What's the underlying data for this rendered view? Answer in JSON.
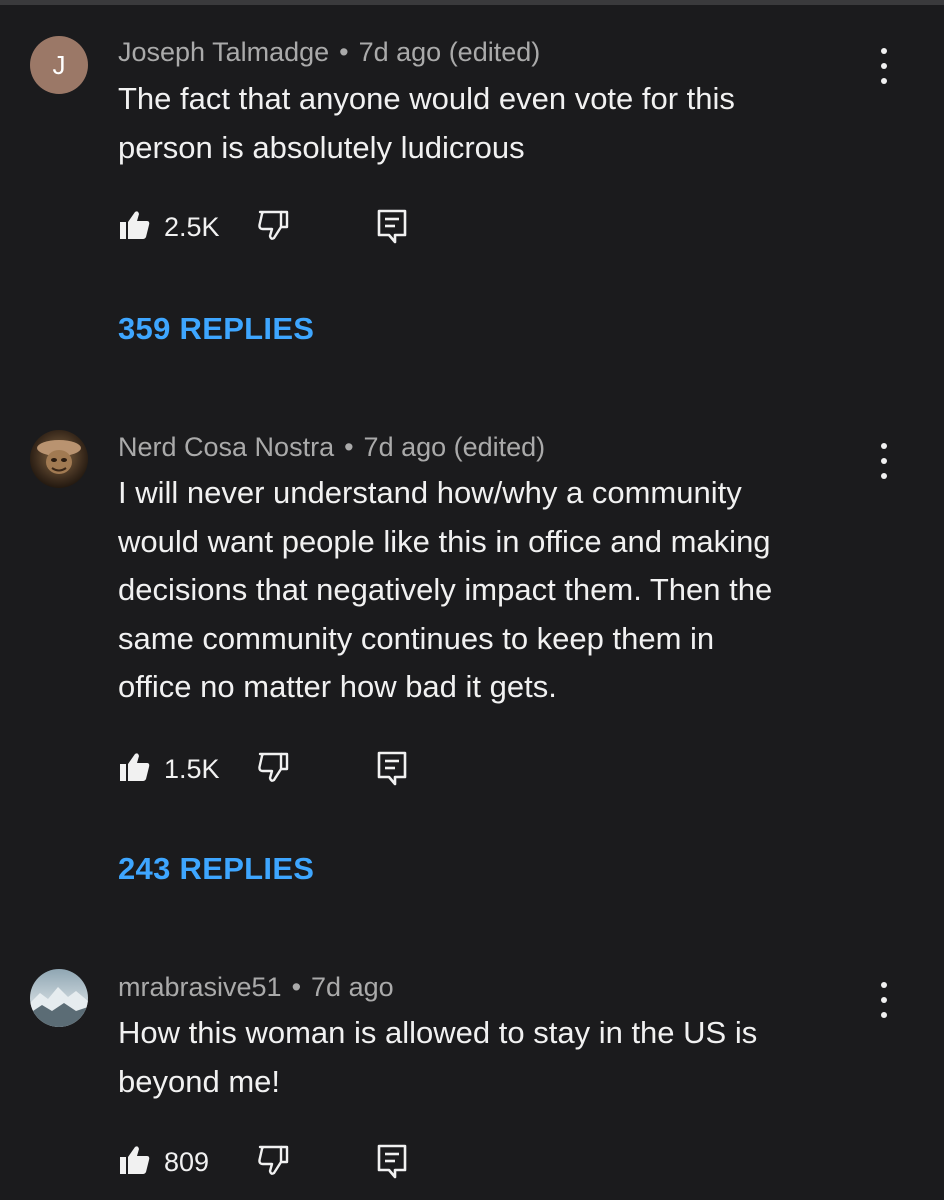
{
  "comments": [
    {
      "avatar_letter": "J",
      "author": "Joseph Talmadge",
      "time": "7d ago (edited)",
      "text_lines": [
        "The fact that anyone would even vote for this",
        "person is absolutely ludicrous"
      ],
      "likes": "2.5K",
      "replies": "359 REPLIES"
    },
    {
      "avatar_letter": "",
      "author": "Nerd Cosa Nostra",
      "time": "7d ago (edited)",
      "text_lines": [
        "I will never understand how/why a community",
        "would want people like this in office and making",
        "decisions that negatively impact them. Then the",
        "same community continues to keep them in",
        "office no matter how bad it gets."
      ],
      "likes": "1.5K",
      "replies": "243 REPLIES"
    },
    {
      "avatar_letter": "",
      "author": "mrabrasive51",
      "time": "7d ago",
      "text_lines": [
        "How this woman is allowed to stay in the US is",
        "beyond me!"
      ],
      "likes": "809"
    }
  ],
  "separator": "•",
  "icons": {
    "like": "thumbs-up-icon",
    "dislike": "thumbs-down-icon",
    "reply": "reply-comment-icon",
    "more": "more-vertical-icon"
  },
  "colors": {
    "background": "#1b1b1d",
    "text": "#f1f1f1",
    "meta": "#aaaaaa",
    "link": "#3ea6ff",
    "avatar_j": "#9b7867"
  }
}
